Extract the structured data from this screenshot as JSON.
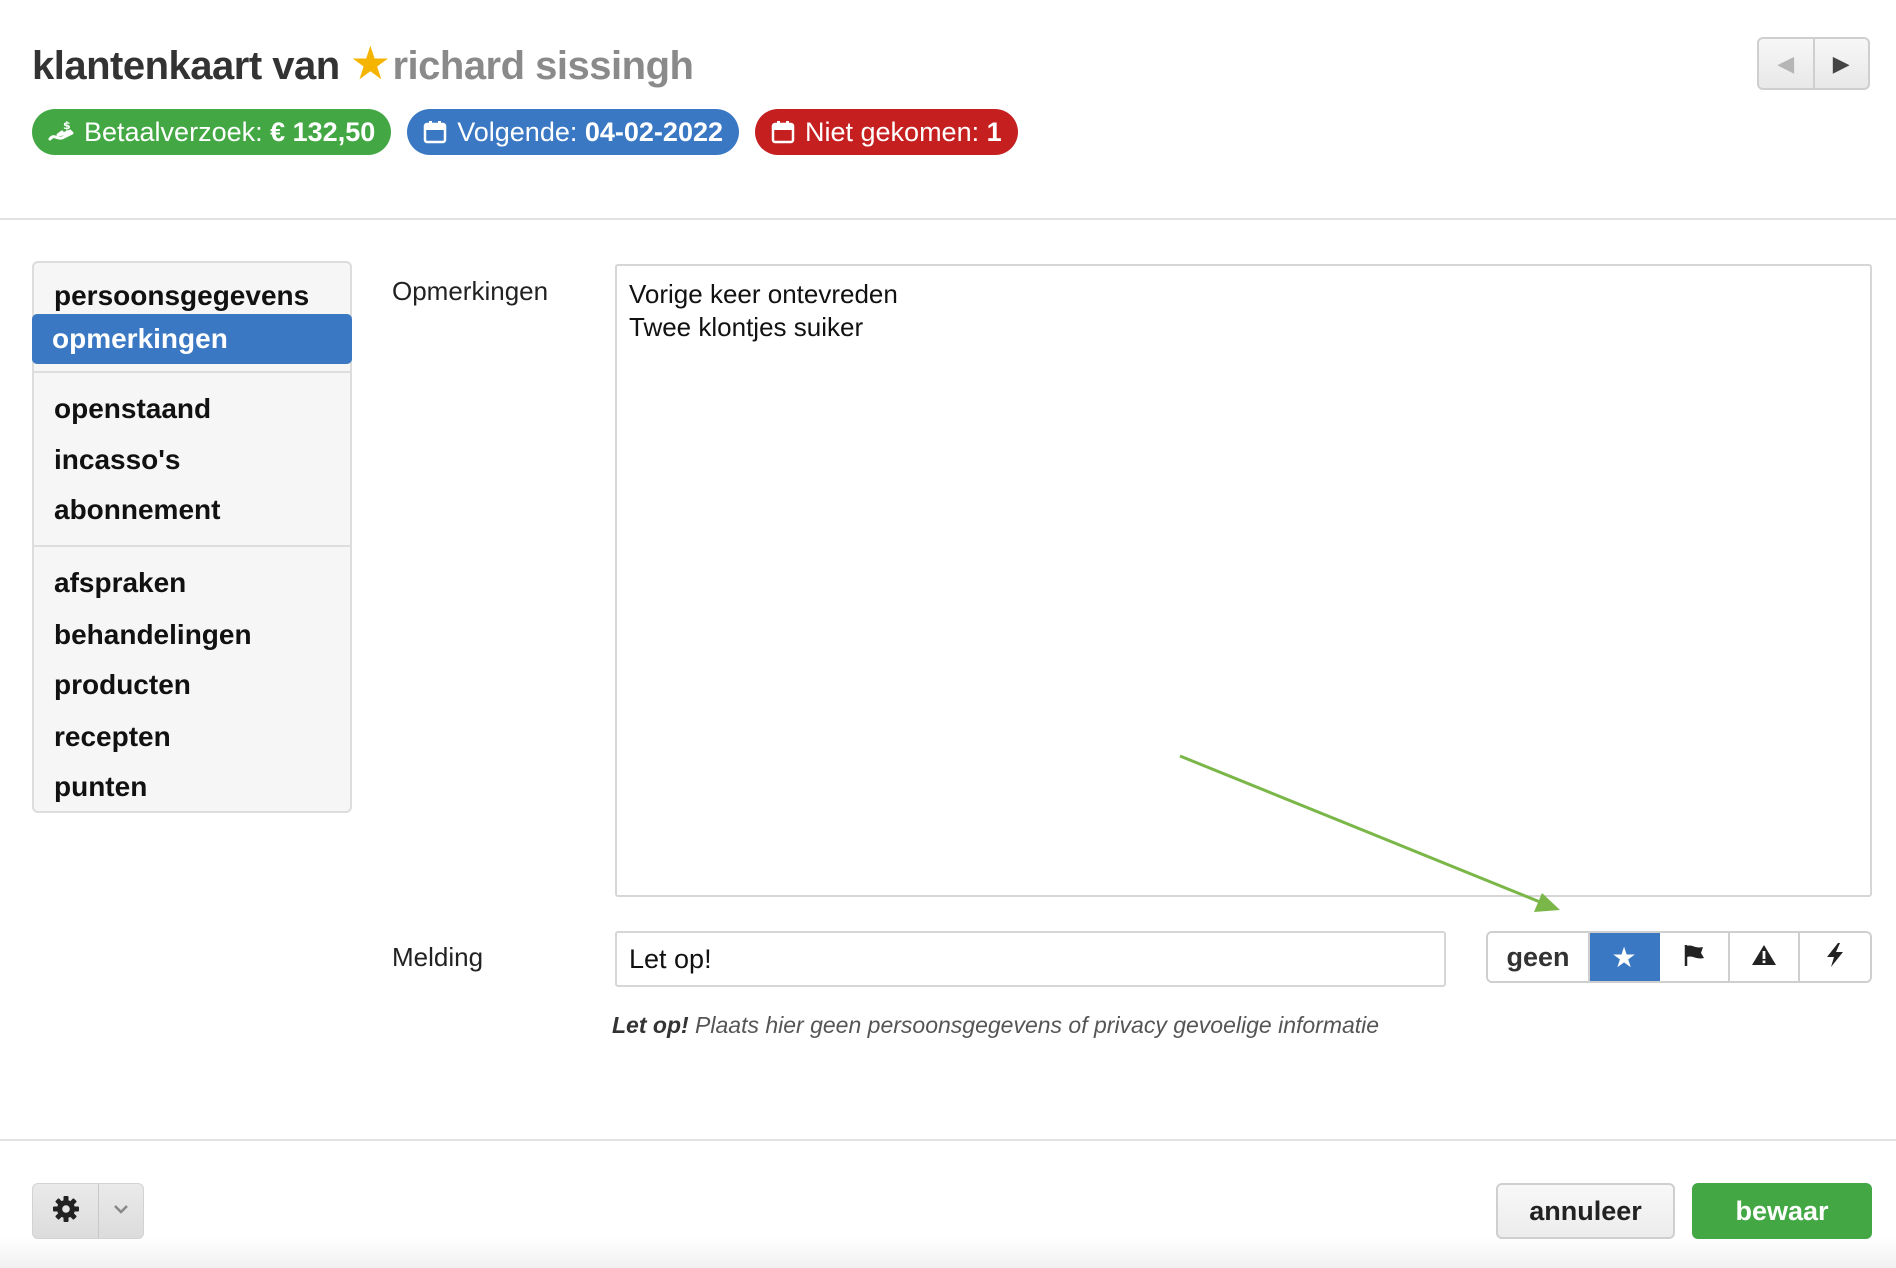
{
  "header": {
    "title_prefix": "klantenkaart van",
    "customer_name": "richard sissingh",
    "badges": {
      "payment": {
        "label": "Betaalverzoek:",
        "value": "€ 132,50",
        "icon": "money-hand-icon"
      },
      "next": {
        "label": "Volgende:",
        "value": "04-02-2022",
        "icon": "calendar-icon"
      },
      "noshow": {
        "label": "Niet gekomen:",
        "value": "1",
        "icon": "calendar-icon"
      }
    }
  },
  "sidebar": {
    "items": [
      {
        "label": "persoonsgegevens"
      },
      {
        "label": "opmerkingen",
        "active": true
      },
      {
        "label": "openstaand"
      },
      {
        "label": "incasso's"
      },
      {
        "label": "abonnement"
      },
      {
        "label": "afspraken"
      },
      {
        "label": "behandelingen"
      },
      {
        "label": "producten"
      },
      {
        "label": "recepten"
      },
      {
        "label": "punten"
      }
    ]
  },
  "form": {
    "remarks_label": "Opmerkingen",
    "remarks_lines": [
      "Vorige keer ontevreden",
      "Twee klontjes suiker"
    ],
    "notice_label": "Melding",
    "notice_value": "Let op!",
    "notice_types": [
      {
        "label": "geen"
      },
      {
        "icon": "star-icon",
        "active": true
      },
      {
        "icon": "flag-icon"
      },
      {
        "icon": "warning-icon"
      },
      {
        "icon": "lightning-icon"
      }
    ],
    "hint_bold": "Let op!",
    "hint_text": "Plaats hier geen persoonsgegevens of privacy gevoelige informatie"
  },
  "footer": {
    "cancel_label": "annuleer",
    "save_label": "bewaar"
  },
  "colors": {
    "primary": "#3a78c3",
    "success": "#43a844",
    "danger": "#c51f1f",
    "star": "#f5b400",
    "annotation_arrow": "#7ab648"
  }
}
